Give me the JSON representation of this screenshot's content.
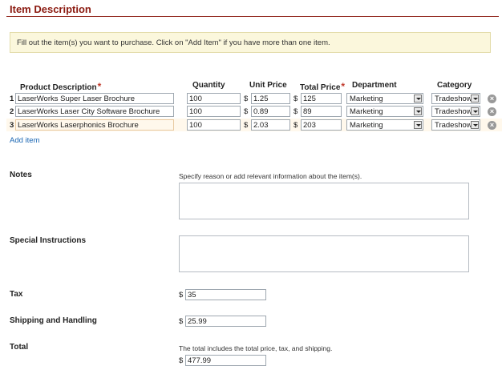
{
  "section_title": "Item Description",
  "notice": "Fill out the item(s) you want to purchase. Click on \"Add Item\" if you have more than one item.",
  "columns": {
    "product": "Product Description",
    "quantity": "Quantity",
    "unit_price": "Unit Price",
    "total_price": "Total Price",
    "department": "Department",
    "category": "Category",
    "required_mark": "*"
  },
  "currency": "$",
  "rows": [
    {
      "num": "1",
      "product": "LaserWorks Super Laser Brochure",
      "quantity": "100",
      "unit_price": "1.25",
      "total_price": "125",
      "department": "Marketing",
      "category": "Tradeshow"
    },
    {
      "num": "2",
      "product": "LaserWorks Laser City Software Brochure",
      "quantity": "100",
      "unit_price": "0.89",
      "total_price": "89",
      "department": "Marketing",
      "category": "Tradeshow"
    },
    {
      "num": "3",
      "product": "LaserWorks Laserphonics Brochure",
      "quantity": "100",
      "unit_price": "2.03",
      "total_price": "203",
      "department": "Marketing",
      "category": "Tradeshow"
    }
  ],
  "add_item": "Add item",
  "notes": {
    "label": "Notes",
    "hint": "Specify reason or add relevant information about the item(s).",
    "value": ""
  },
  "special": {
    "label": "Special Instructions",
    "value": ""
  },
  "tax": {
    "label": "Tax",
    "value": "35"
  },
  "shipping": {
    "label": "Shipping and Handling",
    "value": "25.99"
  },
  "total": {
    "label": "Total",
    "hint": "The total includes the total price, tax, and shipping.",
    "value": "477.99"
  }
}
